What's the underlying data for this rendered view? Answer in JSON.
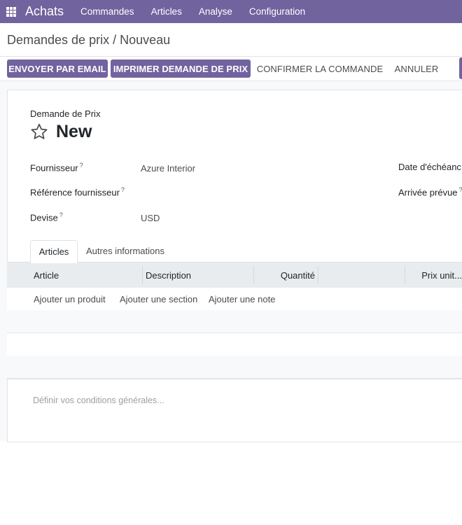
{
  "navbar": {
    "app_name": "Achats",
    "menu": [
      "Commandes",
      "Articles",
      "Analyse",
      "Configuration"
    ],
    "color": "#71639e"
  },
  "breadcrumb": "Demandes de prix / Nouveau",
  "actions": {
    "send_email": "ENVOYER PAR EMAIL",
    "print_rfq": "IMPRIMER DEMANDE DE PRIX",
    "confirm_order": "CONFIRMER LA COMMANDE",
    "cancel": "ANNULER"
  },
  "form": {
    "kind": "Demande de Prix",
    "title": "New",
    "fields": {
      "supplier_label": "Fournisseur",
      "supplier_value": "Azure Interior",
      "supplier_ref_label": "Référence fournisseur",
      "supplier_ref_value": "",
      "currency_label": "Devise",
      "currency_value": "USD",
      "deadline_label": "Date d'échéanc",
      "expected_arrival_label": "Arrivée prévue",
      "help_mark": "?"
    },
    "tabs": [
      "Articles",
      "Autres informations"
    ],
    "table": {
      "columns": [
        "Article",
        "Description",
        "Quantité",
        "",
        "Prix unit..."
      ],
      "add_links": [
        "Ajouter un produit",
        "Ajouter une section",
        "Ajouter une note"
      ]
    },
    "terms_placeholder": "Définir vos conditions générales..."
  }
}
